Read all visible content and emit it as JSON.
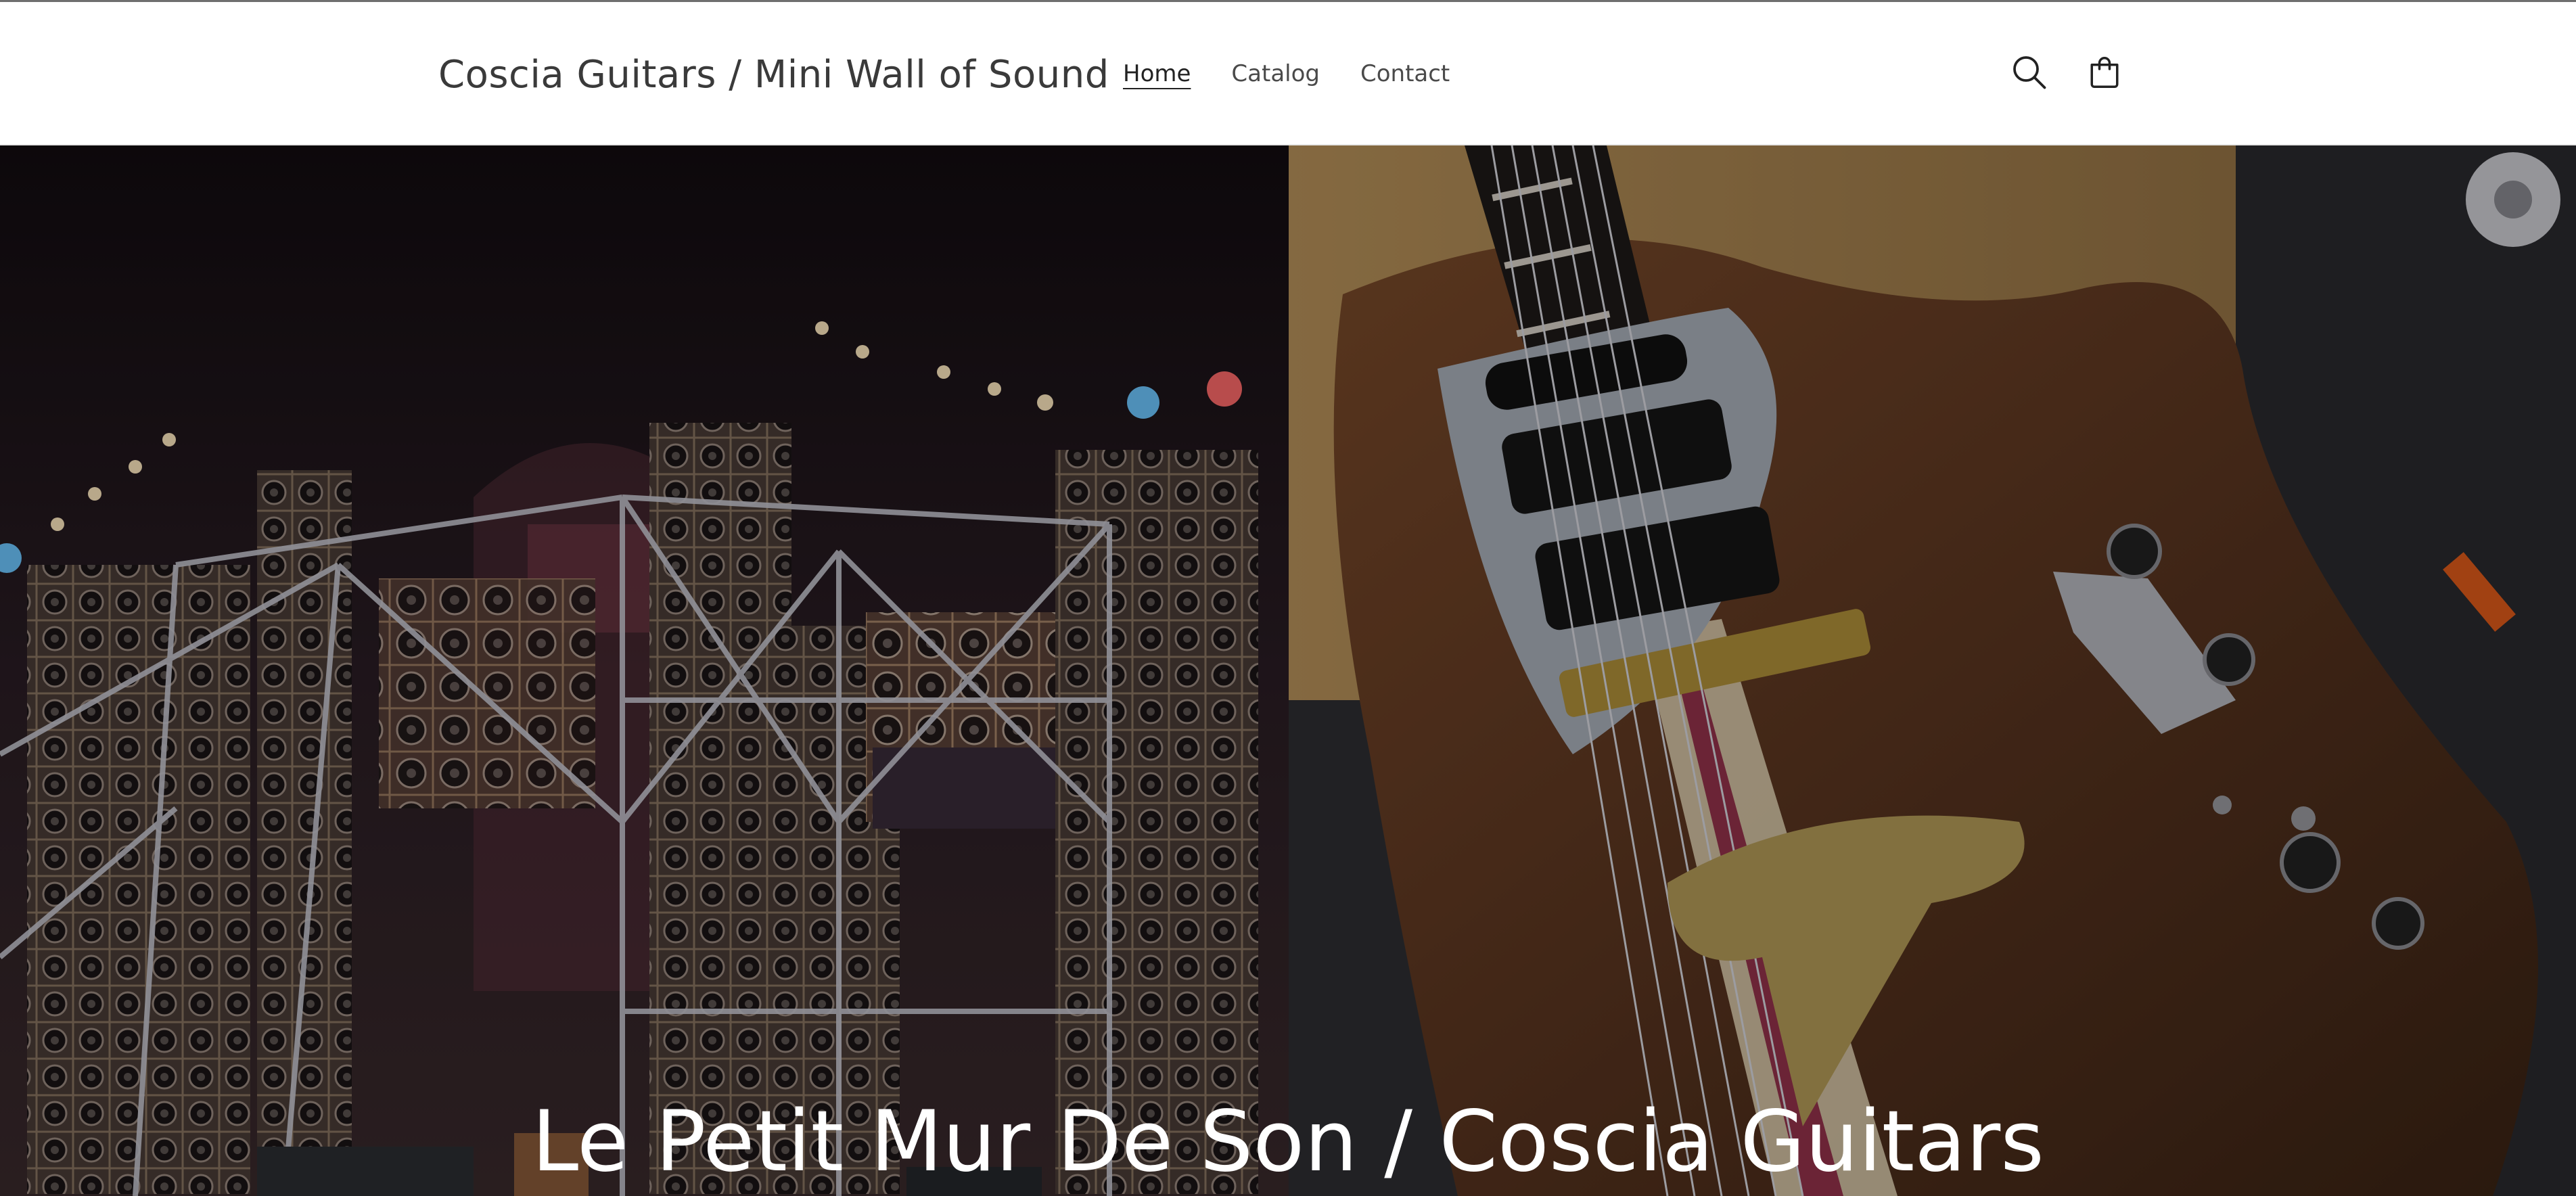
{
  "header": {
    "brand": "Coscia Guitars / Mini Wall of Sound",
    "nav": [
      {
        "label": "Home",
        "active": true
      },
      {
        "label": "Catalog",
        "active": false
      },
      {
        "label": "Contact",
        "active": false
      }
    ],
    "icons": {
      "search": "search-icon",
      "cart": "cart-icon"
    }
  },
  "hero": {
    "heading": "Le Petit Mur De Son / Coscia Guitars",
    "images": [
      {
        "description_icon": "speaker-wall-image"
      },
      {
        "description_icon": "guitar-body-image"
      }
    ]
  },
  "colors": {
    "text_dark": "#3a3a3a",
    "hero_text": "#ffffff",
    "background": "#ffffff"
  }
}
